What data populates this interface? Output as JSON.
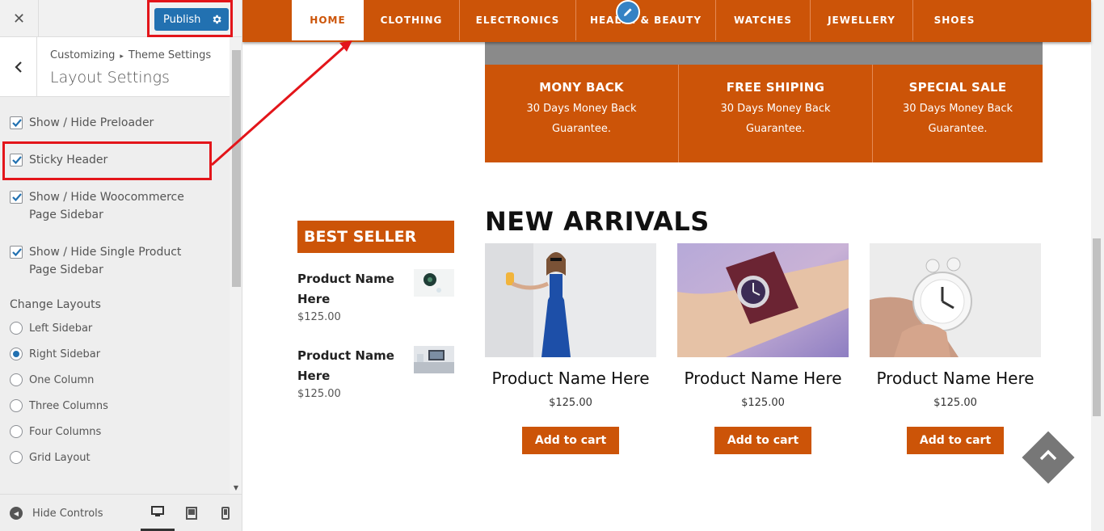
{
  "sidebar": {
    "close_label": "✕",
    "publish_label": "Publish",
    "breadcrumb": {
      "root": "Customizing",
      "separator": "▸",
      "parent": "Theme Settings"
    },
    "section_title": "Layout Settings",
    "checkboxes": [
      {
        "label": "Show / Hide Preloader",
        "checked": true
      },
      {
        "label": "Sticky Header",
        "checked": true
      },
      {
        "label": "Show / Hide Woocommerce Page Sidebar",
        "checked": true
      },
      {
        "label": "Show / Hide Single Product Page Sidebar",
        "checked": true
      }
    ],
    "layouts_title": "Change Layouts",
    "layouts": [
      {
        "label": "Left Sidebar",
        "selected": false
      },
      {
        "label": "Right Sidebar",
        "selected": true
      },
      {
        "label": "One Column",
        "selected": false
      },
      {
        "label": "Three Columns",
        "selected": false
      },
      {
        "label": "Four Columns",
        "selected": false
      },
      {
        "label": "Grid Layout",
        "selected": false
      }
    ],
    "hide_controls_label": "Hide Controls",
    "devices": [
      "desktop-icon",
      "tablet-icon",
      "mobile-icon"
    ],
    "active_device": "desktop"
  },
  "preview": {
    "nav": [
      "HOME",
      "CLOTHING",
      "ELECTRONICS",
      "HEALTH & BEAUTY",
      "WATCHES",
      "JEWELLERY",
      "SHOES"
    ],
    "nav_active": "HOME",
    "features": [
      {
        "title": "MONY BACK",
        "desc": "30 Days Money Back Guarantee."
      },
      {
        "title": "FREE SHIPING",
        "desc": "30 Days Money Back Guarantee."
      },
      {
        "title": "SPECIAL SALE",
        "desc": "30 Days Money Back Guarantee."
      }
    ],
    "best_seller": {
      "title": "BEST SELLER",
      "items": [
        {
          "name": "Product Name Here",
          "price": "$125.00"
        },
        {
          "name": "Product Name Here",
          "price": "$125.00"
        }
      ]
    },
    "new_arrivals": {
      "title": "NEW ARRIVALS",
      "products": [
        {
          "name": "Product Name Here",
          "price": "$125.00",
          "button": "Add to cart"
        },
        {
          "name": "Product Name Here",
          "price": "$125.00",
          "button": "Add to cart"
        },
        {
          "name": "Product Name Here",
          "price": "$125.00",
          "button": "Add to cart"
        }
      ]
    }
  },
  "colors": {
    "brand": "#cc5408",
    "publish": "#2271b1",
    "annotation": "#e3151a"
  }
}
